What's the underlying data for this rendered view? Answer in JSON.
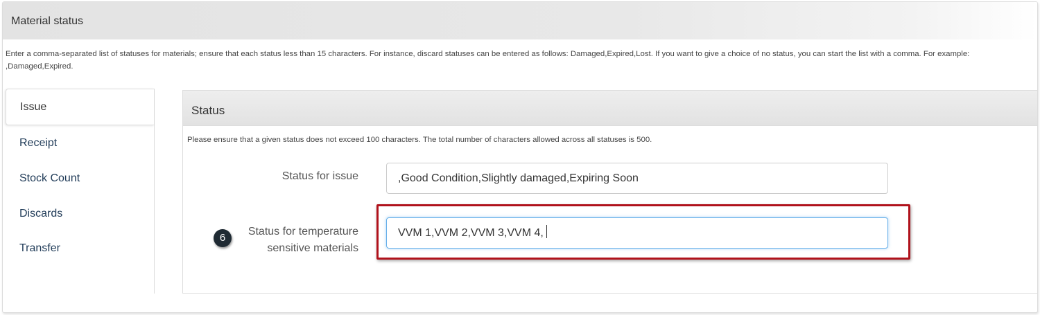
{
  "outer": {
    "title": "Material status",
    "description": "Enter a comma-separated list of statuses for materials; ensure that each status less than 15 characters. For instance, discard statuses can be entered as follows: Damaged,Expired,Lost. If you want to give a choice of no status, you can start the list with a comma. For example: ,Damaged,Expired."
  },
  "tabs": {
    "active": "Issue",
    "items": [
      "Receipt",
      "Stock Count",
      "Discards",
      "Transfer"
    ]
  },
  "status_panel": {
    "title": "Status",
    "description": "Please ensure that a given status does not exceed 100 characters. The total number of characters allowed across all statuses is 500.",
    "fields": [
      {
        "label": "Status for issue",
        "value": ",Good Condition,Slightly damaged,Expiring Soon"
      },
      {
        "label_line1": "Status for temperature",
        "label_line2": "sensitive materials",
        "value": "VVM 1,VVM 2,VVM 3,VVM 4,"
      }
    ]
  },
  "annotation": {
    "step_number": "6",
    "highlight_color": "#b0121c"
  }
}
